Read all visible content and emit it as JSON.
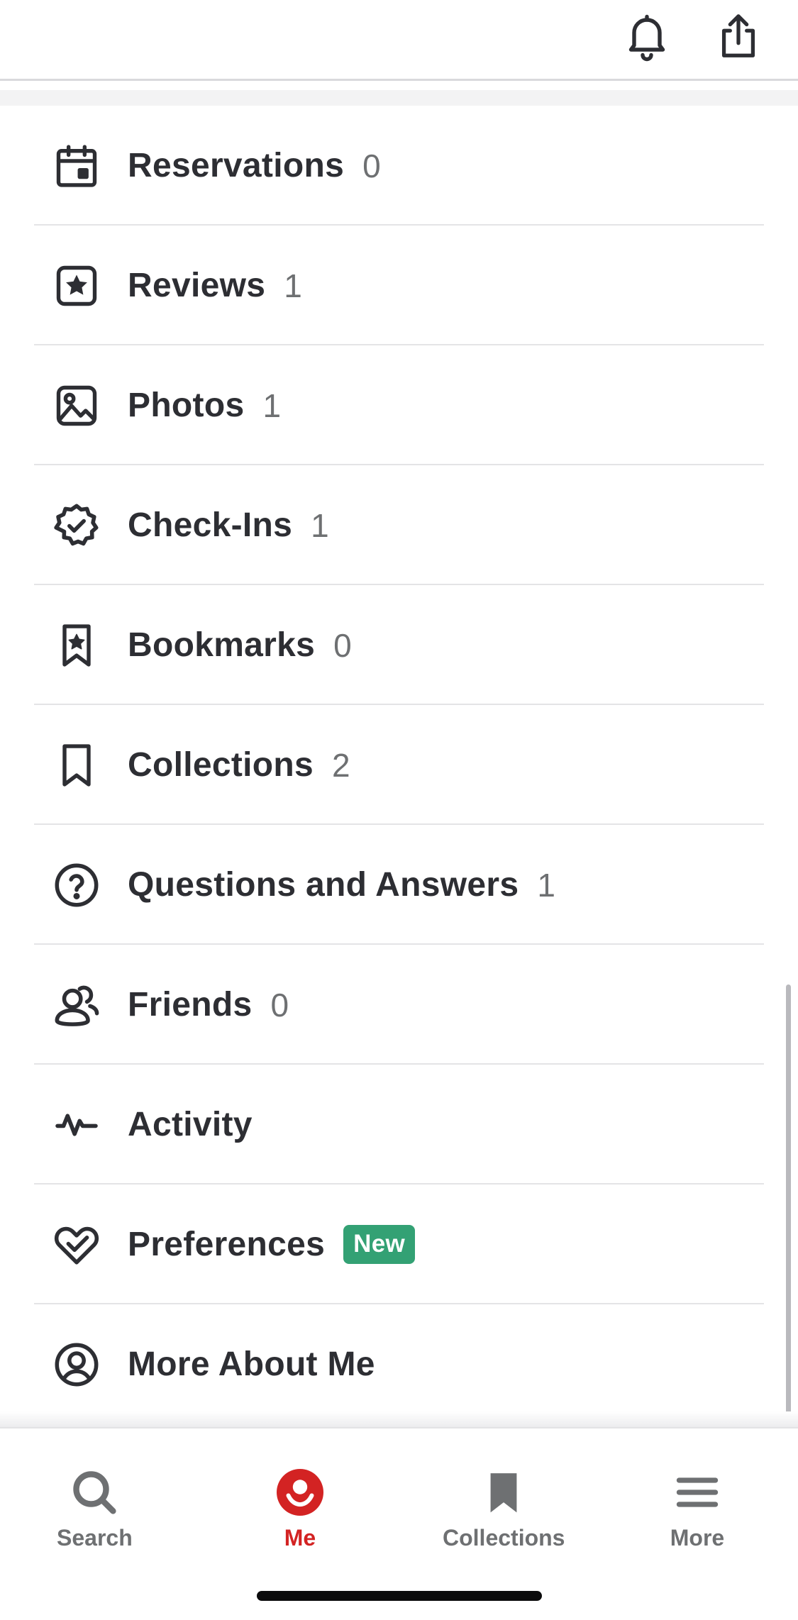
{
  "header": {
    "icons": [
      "bell-icon",
      "share-icon"
    ]
  },
  "menu": {
    "items": [
      {
        "label": "Reservations",
        "count": "0",
        "icon": "calendar-icon"
      },
      {
        "label": "Reviews",
        "count": "1",
        "icon": "star-square-icon"
      },
      {
        "label": "Photos",
        "count": "1",
        "icon": "image-icon"
      },
      {
        "label": "Check-Ins",
        "count": "1",
        "icon": "check-badge-icon"
      },
      {
        "label": "Bookmarks",
        "count": "0",
        "icon": "bookmark-star-icon"
      },
      {
        "label": "Collections",
        "count": "2",
        "icon": "bookmark-icon"
      },
      {
        "label": "Questions and Answers",
        "count": "1",
        "icon": "question-circle-icon"
      },
      {
        "label": "Friends",
        "count": "0",
        "icon": "friends-icon"
      },
      {
        "label": "Activity",
        "icon": "activity-icon"
      },
      {
        "label": "Preferences",
        "badge": "New",
        "icon": "heart-check-icon"
      },
      {
        "label": "More About Me",
        "icon": "user-circle-icon"
      }
    ]
  },
  "tabbar": {
    "tabs": [
      {
        "label": "Search",
        "icon": "search-icon"
      },
      {
        "label": "Me",
        "icon": "me-icon",
        "active": true
      },
      {
        "label": "Collections",
        "icon": "collections-icon"
      },
      {
        "label": "More",
        "icon": "menu-icon"
      }
    ]
  },
  "colors": {
    "accent": "#d32323",
    "badge": "#33a174",
    "text": "#2d2e33",
    "muted": "#6e7072"
  }
}
